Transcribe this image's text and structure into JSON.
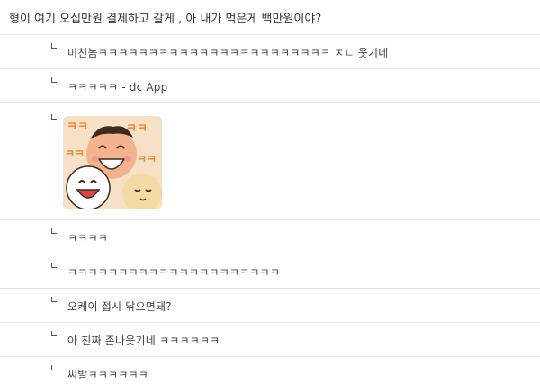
{
  "post": {
    "title": "형이 여기 오십만원 결제하고 갈게 , 아 내가 먹은게 백만원이야?"
  },
  "comments": [
    {
      "text": "미친놈ㅋㅋㅋㅋㅋㅋㅋㅋㅋㅋㅋㅋㅋㅋㅋㅋㅋㅋㅋㅋㅋㅋㅋ ㅈㄴ 웃기네"
    },
    {
      "text": "ㅋㅋㅋㅋㅋ - dc App"
    },
    {
      "text": "",
      "emoticon": "laughing-faces-emoticon"
    },
    {
      "text": "ㅋㅋㅋㅋ"
    },
    {
      "text": "ㅋㅋㅋㅋㅋㅋㅋㅋㅋㅋㅋㅋㅋㅋㅋㅋㅋㅋㅋㅋㅋ"
    },
    {
      "text": "오케이 접시 닦으면돼?"
    },
    {
      "text": "아 진짜 존나웃기네 ㅋㅋㅋㅋㅋㅋ"
    },
    {
      "text": "씨발ㅋㅋㅋㅋㅋㅋ"
    }
  ],
  "colors": {
    "divider": "#e4e4e4",
    "text": "#444444"
  }
}
